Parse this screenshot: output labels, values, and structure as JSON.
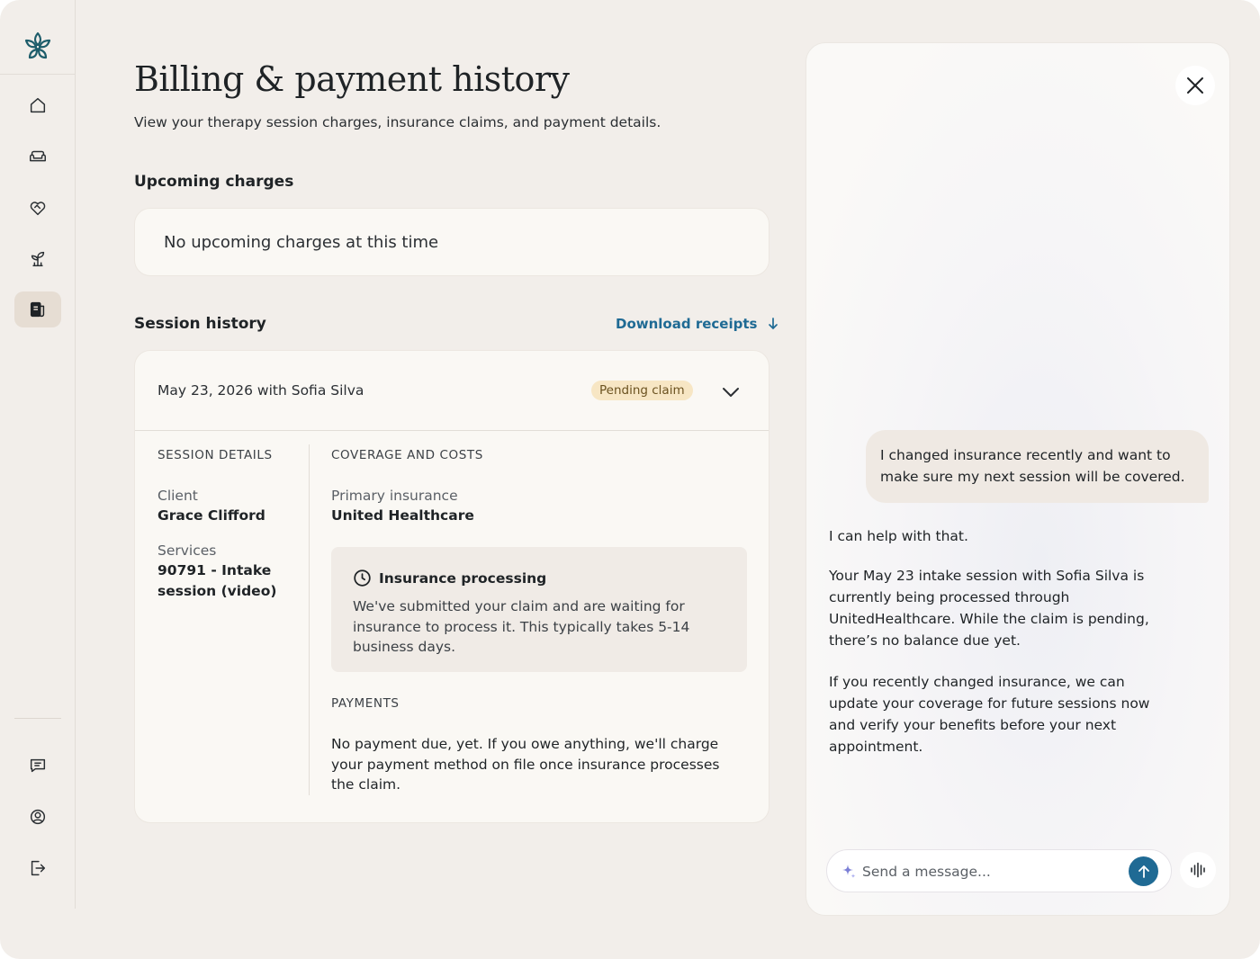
{
  "sidebar": {
    "logo_icon": "flower-logo-icon",
    "items": [
      {
        "icon": "home-icon",
        "name": "nav-home"
      },
      {
        "icon": "sofa-icon",
        "name": "nav-sessions"
      },
      {
        "icon": "heart-handshake-icon",
        "name": "nav-care"
      },
      {
        "icon": "plant-icon",
        "name": "nav-growth"
      },
      {
        "icon": "billing-icon",
        "name": "nav-billing",
        "active": true
      },
      {
        "icon": "message-icon",
        "name": "nav-messages"
      },
      {
        "icon": "profile-icon",
        "name": "nav-profile"
      },
      {
        "icon": "logout-icon",
        "name": "nav-logout"
      }
    ]
  },
  "main": {
    "title": "Billing & payment history",
    "subtitle": "View your therapy session charges, insurance claims, and payment details.",
    "upcoming": {
      "heading": "Upcoming charges",
      "empty_text": "No upcoming charges at this time"
    },
    "history": {
      "heading": "Session history",
      "download_label": "Download receipts",
      "session": {
        "date_label": "May 23, 2026 with Sofia Silva",
        "status": "Pending claim",
        "details_heading": "SESSION DETAILS",
        "client_label": "Client",
        "client_value": "Grace Clifford",
        "services_label": "Services",
        "services_line1": "90791 - Intake",
        "services_line2": "session (video)",
        "coverage_heading": "COVERAGE AND COSTS",
        "insurance_label": "Primary insurance",
        "insurance_value": "United Healthcare",
        "processing_title": "Insurance processing",
        "processing_text": "We've submitted your claim and are waiting for insurance to process it. This typically takes 5-14 business days.",
        "payments_heading": "PAYMENTS",
        "payments_text": "No payment due, yet. If you owe anything, we'll charge your payment method on file once insurance processes the claim."
      }
    }
  },
  "chat": {
    "user_message": "I changed insurance recently and want to make sure my next session will be covered.",
    "bot_messages": [
      "I can help with that.",
      "Your May 23 intake session with Sofia Silva is currently being processed through UnitedHealthcare. While the claim is pending, there’s no balance due yet.",
      "If you recently changed insurance, we can update your coverage for future sessions now and verify your benefits before your next appointment."
    ],
    "input_placeholder": "Send a message...",
    "input_value": ""
  },
  "colors": {
    "accent": "#1f6a94",
    "background": "#f2eeea",
    "badge_bg": "#f7e6c4",
    "logo": "#1e5d6b"
  }
}
